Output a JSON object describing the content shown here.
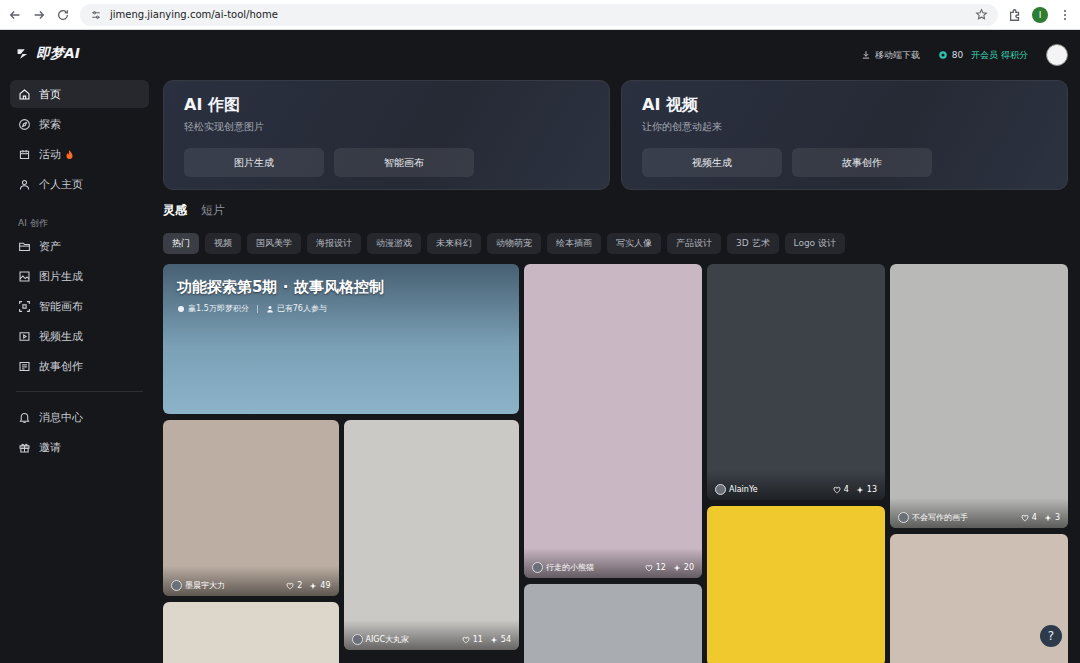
{
  "browser": {
    "url": "jimeng.jianying.com/ai-tool/home",
    "profile": "I"
  },
  "logo": {
    "name": "即梦AI"
  },
  "sidebar": {
    "items": [
      {
        "label": "首页",
        "selected": true,
        "hot": false
      },
      {
        "label": "探索",
        "selected": false,
        "hot": false
      },
      {
        "label": "活动",
        "selected": false,
        "hot": true
      },
      {
        "label": "个人主页",
        "selected": false,
        "hot": false
      }
    ],
    "section": "AI 创作",
    "creation_items": [
      {
        "label": "资产",
        "selected": false
      },
      {
        "label": "图片生成",
        "selected": false
      },
      {
        "label": "智能画布",
        "selected": false
      },
      {
        "label": "视频生成",
        "selected": false
      },
      {
        "label": "故事创作",
        "selected": false
      }
    ],
    "bottom_items": [
      {
        "label": "消息中心",
        "selected": false
      },
      {
        "label": "邀请",
        "selected": false
      }
    ]
  },
  "topbar": {
    "download": "移动端下载",
    "points": "80",
    "vip": "开会员 得积分"
  },
  "hero": [
    {
      "title": "AI 作图",
      "subtitle": "轻松实现创意图片",
      "buttons": [
        "图片生成",
        "智能画布"
      ]
    },
    {
      "title": "AI 视频",
      "subtitle": "让你的创意动起来",
      "buttons": [
        "视频生成",
        "故事创作"
      ]
    }
  ],
  "tabs": [
    {
      "label": "灵感",
      "selected": true
    },
    {
      "label": "短片",
      "selected": false
    }
  ],
  "chips": [
    {
      "label": "热门",
      "selected": true
    },
    {
      "label": "视频",
      "selected": false
    },
    {
      "label": "国风美学",
      "selected": false
    },
    {
      "label": "海报设计",
      "selected": false
    },
    {
      "label": "动漫游戏",
      "selected": false
    },
    {
      "label": "未来科幻",
      "selected": false
    },
    {
      "label": "动物萌宠",
      "selected": false
    },
    {
      "label": "绘本插画",
      "selected": false
    },
    {
      "label": "写实人像",
      "selected": false
    },
    {
      "label": "产品设计",
      "selected": false
    },
    {
      "label": "3D 艺术",
      "selected": false
    },
    {
      "label": "Logo 设计",
      "selected": false
    }
  ],
  "gallery": {
    "banner": {
      "title": "功能探索第5期 · 故事风格控制",
      "reward": "赢1.5万即梦积分",
      "participants": "已有76人参与",
      "color": "#86afc6"
    },
    "columns": [
      [
        {
          "author": "墨晨宇大力",
          "likes": "2",
          "uses": "49",
          "color": "#bcaea3"
        },
        {
          "color": "#dcd6cb"
        }
      ],
      [
        {
          "author": "AIGC大丸家",
          "likes": "11",
          "uses": "54",
          "color": "#cbc9c6"
        }
      ],
      [
        {
          "author": "行走的小熊猫",
          "likes": "12",
          "uses": "20",
          "color": "#c9b7c4"
        },
        {
          "color": "#a9adb2"
        }
      ],
      [
        {
          "author": "AlainYe",
          "likes": "4",
          "uses": "13",
          "color": "#3d4249"
        },
        {
          "color": "#f0c92e"
        }
      ],
      [
        {
          "author": "不会写作的画手",
          "likes": "4",
          "uses": "3",
          "color": "#b9b9b7"
        },
        {
          "color": "#cdbfb4"
        }
      ]
    ]
  },
  "help": "?"
}
